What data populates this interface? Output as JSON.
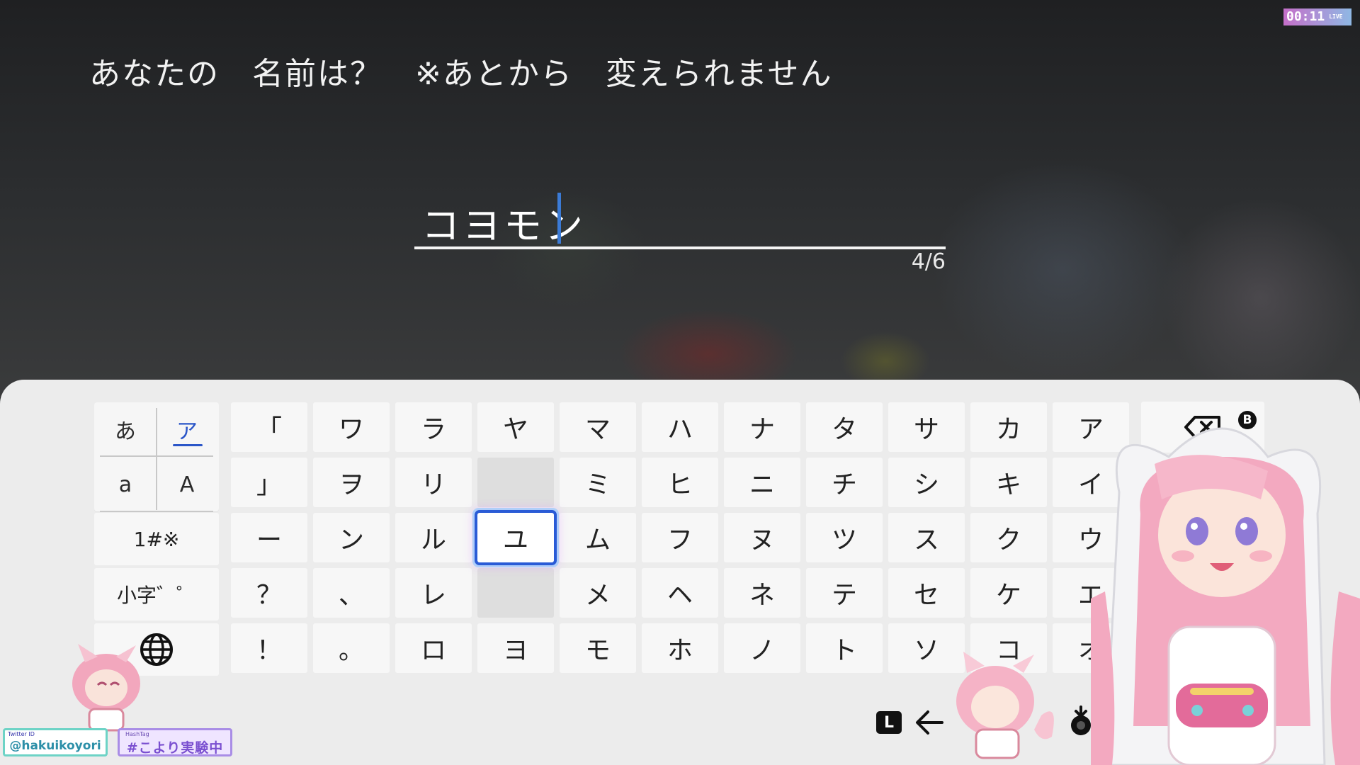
{
  "header": {
    "prompt": "あなたの　名前は？　※あとから　変えられません",
    "timer": "00:11",
    "timer_badge": "LIVE"
  },
  "name_entry": {
    "value": "コヨモン",
    "counter": "4/6"
  },
  "mode_selector": {
    "hiragana": "あ",
    "katakana": "ア",
    "lower_latin": "a",
    "upper_latin": "A",
    "symbols": "1#※",
    "small_kana": "小字゛゜",
    "globe_icon": "globe-icon",
    "active": "katakana"
  },
  "keyboard": {
    "columns": [
      [
        "「",
        "」",
        "ー",
        "？",
        "！"
      ],
      [
        "ワ",
        "ヲ",
        "ン",
        "、",
        "。"
      ],
      [
        "ラ",
        "リ",
        "ル",
        "レ",
        "ロ"
      ],
      [
        "ヤ",
        "",
        "ユ",
        "",
        "ヨ"
      ],
      [
        "マ",
        "ミ",
        "ム",
        "メ",
        "モ"
      ],
      [
        "ハ",
        "ヒ",
        "フ",
        "ヘ",
        "ホ"
      ],
      [
        "ナ",
        "ニ",
        "ヌ",
        "ネ",
        "ノ"
      ],
      [
        "タ",
        "チ",
        "ツ",
        "テ",
        "ト"
      ],
      [
        "サ",
        "シ",
        "ス",
        "セ",
        "ソ"
      ],
      [
        "カ",
        "キ",
        "ク",
        "ケ",
        "コ"
      ],
      [
        "ア",
        "イ",
        "ウ",
        "エ",
        "オ"
      ]
    ],
    "selected_key": "ユ",
    "backspace_icon": "backspace-icon",
    "backspace_button_hint": "B"
  },
  "footer": {
    "l_button": "L",
    "arrow_icon": "arrow-left-icon",
    "stick_icon": "stick-press-icon"
  },
  "overlay": {
    "twitter_label": "Twitter ID",
    "twitter_handle": "@hakuikoyori",
    "hashtag_label": "HashTag",
    "hashtag": "#こより実験中"
  }
}
